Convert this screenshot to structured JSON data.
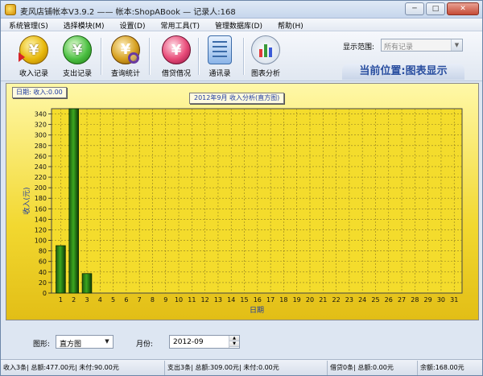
{
  "window": {
    "title": "麦风店铺帐本V3.9.2 —— 帐本:ShopABook — 记录人:168",
    "min": "─",
    "max": "□",
    "close": "✕"
  },
  "menu": [
    "系统管理(S)",
    "选择模块(M)",
    "设置(D)",
    "常用工具(T)",
    "管理数据库(D)",
    "帮助(H)"
  ],
  "toolbar": {
    "income": "收入记录",
    "expense": "支出记录",
    "query": "查询统计",
    "loan": "借贷借况",
    "contacts": "通讯录",
    "chart": "图表分析",
    "yen": "¥"
  },
  "scope": {
    "label": "显示范围:",
    "value": "所有记录"
  },
  "location": "当前位置:图表显示",
  "chart_data": {
    "type": "bar",
    "title": "2012年9月 收入分析(直方图)",
    "date_tag": "日期:    收入:0.00",
    "xlabel": "日期",
    "ylabel": "收入(元)",
    "ylim": [
      0,
      350
    ],
    "yticks": [
      0,
      20,
      40,
      60,
      80,
      100,
      120,
      140,
      160,
      180,
      200,
      220,
      240,
      260,
      280,
      300,
      320,
      340
    ],
    "categories": [
      "1",
      "2",
      "3",
      "4",
      "5",
      "6",
      "7",
      "8",
      "9",
      "10",
      "11",
      "12",
      "13",
      "14",
      "15",
      "16",
      "17",
      "18",
      "19",
      "20",
      "21",
      "22",
      "23",
      "24",
      "25",
      "26",
      "27",
      "28",
      "29",
      "30",
      "31"
    ],
    "values": [
      90,
      350,
      37,
      0,
      0,
      0,
      0,
      0,
      0,
      0,
      0,
      0,
      0,
      0,
      0,
      0,
      0,
      0,
      0,
      0,
      0,
      0,
      0,
      0,
      0,
      0,
      0,
      0,
      0,
      0,
      0
    ],
    "grid": true,
    "bar_color": "#3ba71f"
  },
  "controls": {
    "shape_label": "图形:",
    "shape_value": "直方图",
    "month_label": "月份:",
    "month_value": "2012-09"
  },
  "status": [
    "收入3条| 总额:477.00元| 未付:90.00元",
    "支出3条| 总额:309.00元| 未付:0.00元",
    "借贷0条| 总额:0.00元",
    "余额:168.00元"
  ]
}
